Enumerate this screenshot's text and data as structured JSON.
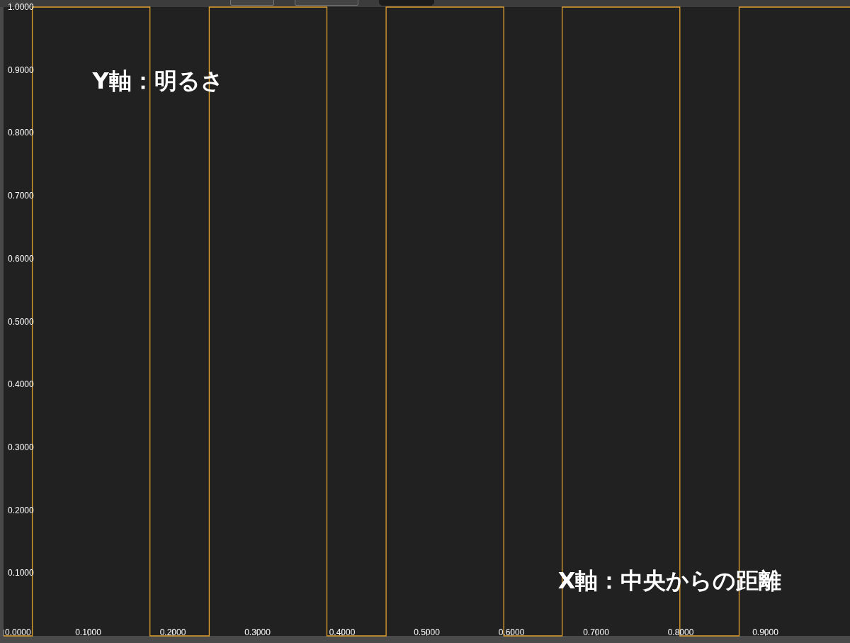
{
  "chart_data": {
    "type": "line",
    "x": [
      0,
      0.034,
      0.034,
      0.173,
      0.173,
      0.243,
      0.243,
      0.382,
      0.382,
      0.452,
      0.452,
      0.591,
      0.591,
      0.66,
      0.66,
      0.799,
      0.799,
      0.869,
      0.869,
      1
    ],
    "series": [
      {
        "color": "#e0a030",
        "values": [
          0,
          0,
          1,
          1,
          0,
          0,
          1,
          1,
          0,
          0,
          1,
          1,
          0,
          0,
          1,
          1,
          0,
          0,
          1,
          1
        ]
      }
    ],
    "xlim": [
      0,
      1
    ],
    "ylim": [
      0,
      1
    ],
    "xticks": [
      {
        "value": 0,
        "label": "0.0000"
      },
      {
        "value": 0.1,
        "label": "0.1000"
      },
      {
        "value": 0.2,
        "label": "0.2000"
      },
      {
        "value": 0.3,
        "label": "0.3000"
      },
      {
        "value": 0.4,
        "label": "0.4000"
      },
      {
        "value": 0.5,
        "label": "0.5000"
      },
      {
        "value": 0.6,
        "label": "0.6000"
      },
      {
        "value": 0.7,
        "label": "0.7000"
      },
      {
        "value": 0.8,
        "label": "0.8000"
      },
      {
        "value": 0.9,
        "label": "0.9000"
      }
    ],
    "yticks": [
      {
        "value": 0.1,
        "label": "0.1000"
      },
      {
        "value": 0.2,
        "label": "0.2000"
      },
      {
        "value": 0.3,
        "label": "0.3000"
      },
      {
        "value": 0.4,
        "label": "0.4000"
      },
      {
        "value": 0.5,
        "label": "0.5000"
      },
      {
        "value": 0.6,
        "label": "0.6000"
      },
      {
        "value": 0.7,
        "label": "0.7000"
      },
      {
        "value": 0.8,
        "label": "0.8000"
      },
      {
        "value": 0.9,
        "label": "0.9000"
      },
      {
        "value": 1,
        "label": "1.0000"
      }
    ],
    "annotations": [
      "Y軸：明るさ",
      "X軸：中央からの距離"
    ]
  }
}
